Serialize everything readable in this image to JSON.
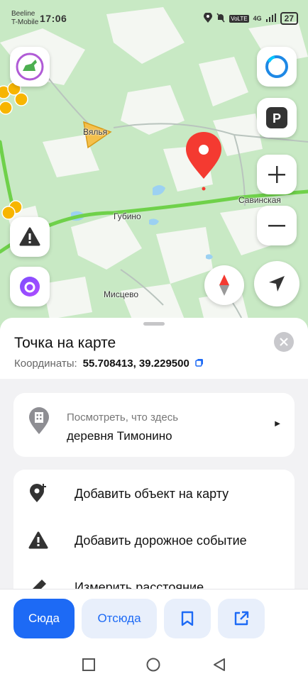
{
  "status_bar": {
    "carrier_line1": "Beeline",
    "carrier_line2": "T-Mobile",
    "time": "17:06",
    "network": "4G",
    "volte": "VoLTE",
    "battery": "27"
  },
  "map": {
    "labels": [
      "Губино",
      "Савинская",
      "Мисцево",
      "Вялья"
    ]
  },
  "sheet": {
    "title": "Точка на карте",
    "coords_label": "Координаты:",
    "coords_value": "55.708413, 39.229500",
    "whats_here": {
      "subtitle": "Посмотреть, что здесь",
      "place": "деревня Тимонино"
    },
    "actions": [
      {
        "label": "Добавить объект на карту",
        "icon": "add-place-icon"
      },
      {
        "label": "Добавить дорожное событие",
        "icon": "warning-icon"
      },
      {
        "label": "Измерить расстояние",
        "icon": "ruler-icon"
      }
    ]
  },
  "bottom_bar": {
    "here_label": "Сюда",
    "from_label": "Отсюда"
  },
  "colors": {
    "accent": "#1d6af5",
    "pin": "#f43a31",
    "road": "#6fd14a"
  }
}
